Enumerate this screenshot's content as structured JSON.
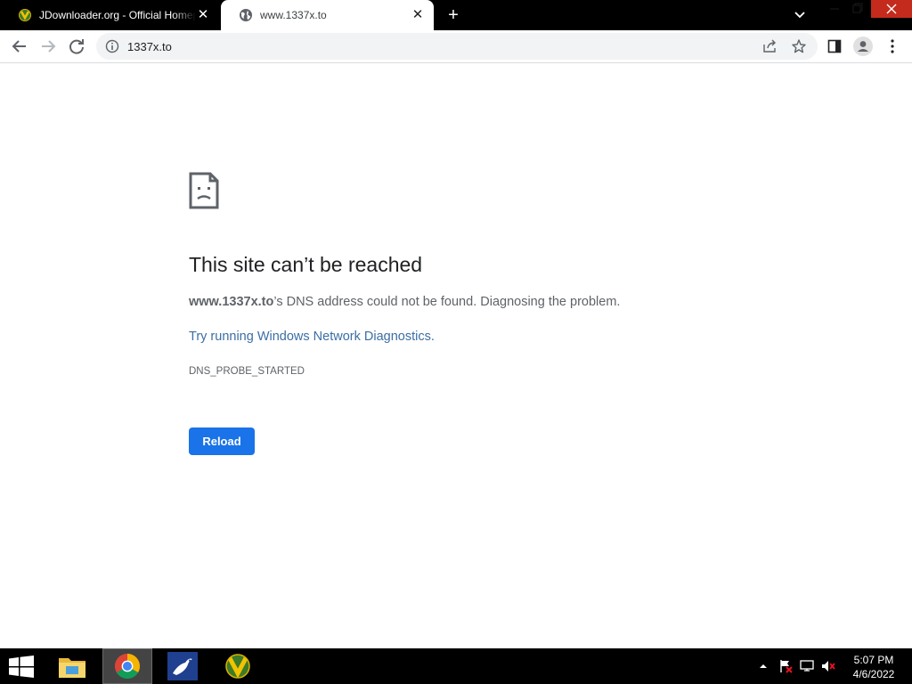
{
  "browser": {
    "tabs": [
      {
        "title": "JDownloader.org - Official Homepage",
        "favicon": "jdownloader-icon",
        "active": false
      },
      {
        "title": "www.1337x.to",
        "favicon": "globe-icon",
        "active": true
      }
    ],
    "omnibox": {
      "url": "1337x.to"
    }
  },
  "error_page": {
    "title": "This site can’t be reached",
    "host": "www.1337x.to",
    "description_suffix": "’s DNS address could not be found. Diagnosing the problem.",
    "suggestion_link": "Try running Windows Network Diagnostics",
    "suggestion_period": ".",
    "error_code": "DNS_PROBE_STARTED",
    "reload_label": "Reload"
  },
  "taskbar": {
    "apps": [
      "file-explorer-icon",
      "chrome-icon",
      "bird-app-icon",
      "jdownloader-icon"
    ],
    "active_app": "chrome-icon",
    "clock": {
      "time": "5:07 PM",
      "date": "4/6/2022"
    }
  },
  "colors": {
    "accent": "#1a73e8",
    "link": "#3b6ea5",
    "window_close": "#c42b1c"
  }
}
